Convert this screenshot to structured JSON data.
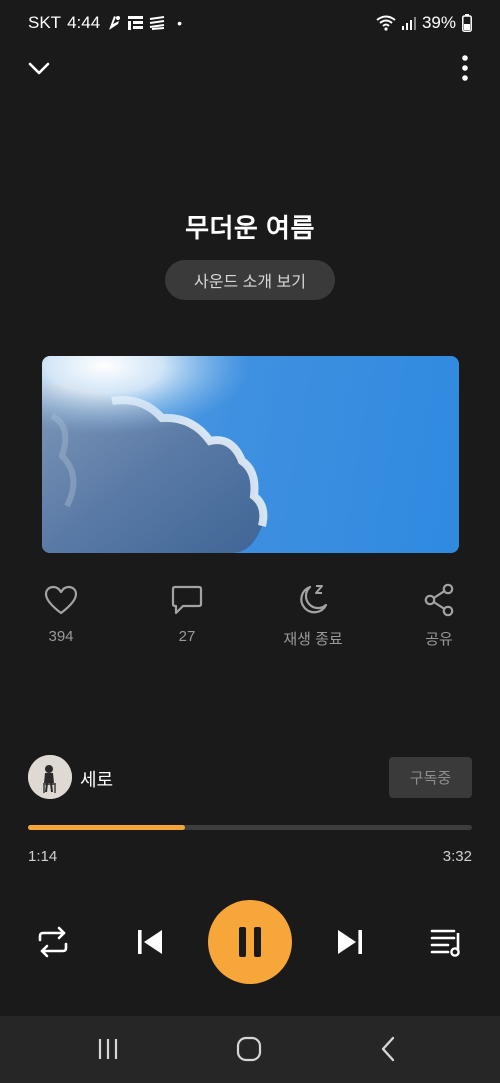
{
  "status_bar": {
    "carrier": "SKT",
    "time": "4:44",
    "dot": "•",
    "battery": "39%",
    "icons": [
      "notification-icon",
      "list-icon",
      "stream-icon",
      "wifi-icon",
      "signal-icon",
      "battery-icon"
    ]
  },
  "header": {
    "collapse_icon": "chevron-down-icon",
    "more_icon": "more-vertical-icon"
  },
  "track": {
    "title": "무더운 여름",
    "sound_intro_label": "사운드 소개 보기"
  },
  "actions": [
    {
      "icon": "heart-icon",
      "label": "394"
    },
    {
      "icon": "comment-icon",
      "label": "27"
    },
    {
      "icon": "sleep-timer-icon",
      "label": "재생 종료"
    },
    {
      "icon": "share-icon",
      "label": "공유"
    }
  ],
  "artist": {
    "name": "세로",
    "subscribe_label": "구독중"
  },
  "playback": {
    "progress_fraction": 0.353,
    "elapsed": "1:14",
    "total": "3:32"
  },
  "controls": {
    "repeat_icon": "repeat-icon",
    "previous_icon": "skip-previous-icon",
    "pause_icon": "pause-icon",
    "next_icon": "skip-next-icon",
    "playlist_icon": "playlist-icon"
  },
  "colors": {
    "accent": "#f7a73a",
    "background": "#1a1a1a",
    "button_bg": "#3a3a3a"
  },
  "nav_bar": {
    "recents_icon": "recents-icon",
    "home_icon": "home-icon",
    "back_icon": "back-icon"
  }
}
